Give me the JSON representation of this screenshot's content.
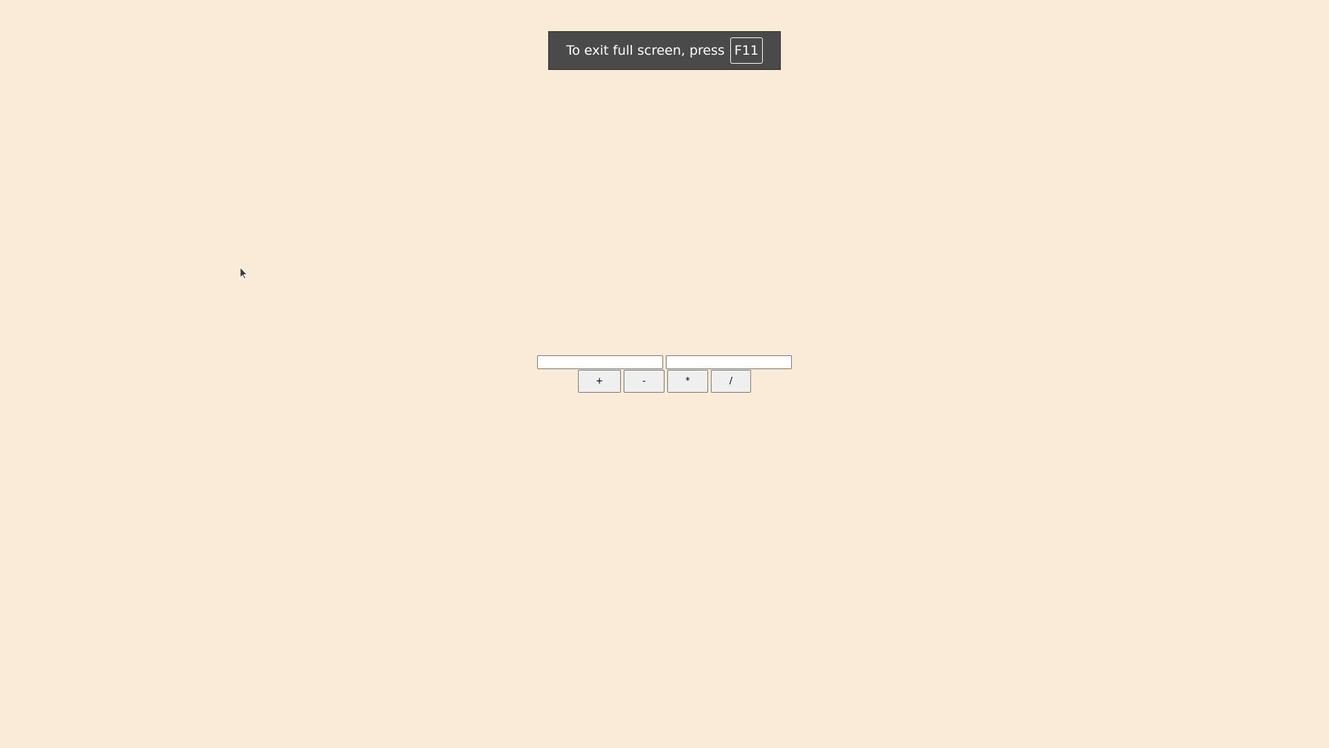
{
  "fullscreen_notice": {
    "text": "To exit full screen, press",
    "key": "F11"
  },
  "calculator": {
    "operand1": {
      "value": "",
      "placeholder": ""
    },
    "operand2": {
      "value": "",
      "placeholder": ""
    },
    "buttons": {
      "add": "+",
      "subtract": "-",
      "multiply": "*",
      "divide": "/"
    }
  },
  "colors": {
    "background": "#faebd7",
    "toast_background": "#4a4a4a"
  },
  "icons": {
    "cursor": "mouse-pointer-icon"
  }
}
